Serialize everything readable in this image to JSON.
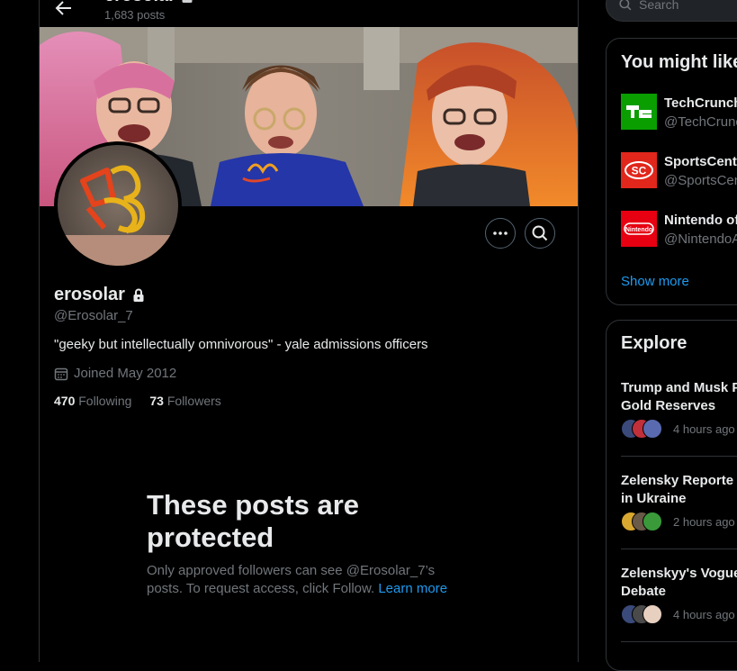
{
  "header": {
    "title": "erosolar",
    "post_count": "1,683 posts"
  },
  "profile": {
    "display_name": "erosolar",
    "handle": "@Erosolar_7",
    "bio": "\"geeky but intellectually omnivorous\" - yale admissions officers",
    "joined": "Joined May 2012",
    "following_count": "470",
    "following_label": "Following",
    "followers_count": "73",
    "followers_label": "Followers"
  },
  "protected": {
    "title": "These posts are protected",
    "body": "Only approved followers can see @Erosolar_7’s posts. To request access, click Follow.",
    "link": "Learn more"
  },
  "search": {
    "placeholder": "Search"
  },
  "suggestions": {
    "title": "You might like",
    "accounts": [
      {
        "name": "TechCrunch",
        "handle": "@TechCrunch",
        "logo_text": "TC",
        "logo_color": "#0a9e01"
      },
      {
        "name": "SportsCenter",
        "handle": "@SportsCenter",
        "logo_text": "SC",
        "logo_color": "#e1261c"
      },
      {
        "name": "Nintendo of America",
        "handle": "@NintendoAmerica",
        "logo_text": "Nintendo",
        "logo_color": "#e60012"
      }
    ],
    "show_more": "Show more"
  },
  "explore": {
    "title": "Explore",
    "trends": [
      {
        "title": "Trump and Musk P",
        "title2": "Gold Reserves",
        "time": "4 hours ago"
      },
      {
        "title": "Zelensky Reporte",
        "title2": "in Ukraine",
        "time": "2 hours ago"
      },
      {
        "title": "Zelenskyy's Vogue",
        "title2": "Debate",
        "time": "4 hours ago"
      }
    ]
  },
  "colors": {
    "background": "#000000",
    "text": "#e7e9ea",
    "muted": "#71767b",
    "accent": "#1d9bf0",
    "border": "#2f3336"
  }
}
